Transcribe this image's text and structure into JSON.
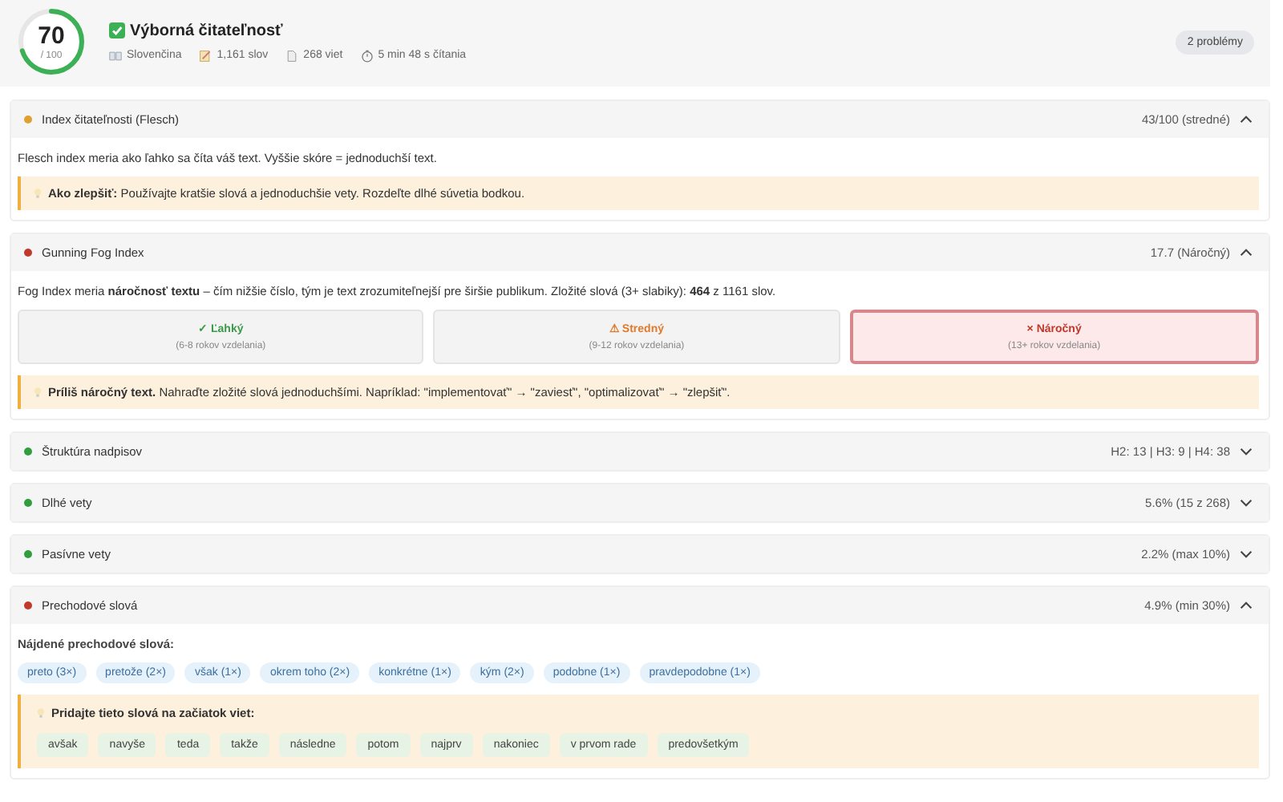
{
  "summary": {
    "score": "70",
    "max": "/ 100",
    "title": "Výborná čitateľnosť",
    "meta": [
      {
        "kind": "language",
        "text": "Slovenčina"
      },
      {
        "kind": "words",
        "text": "1,161 slov"
      },
      {
        "kind": "sentences",
        "text": "268 viet"
      },
      {
        "kind": "time",
        "text": "5 min 48 s čítania"
      }
    ],
    "badge": "2 problémy"
  },
  "sections": [
    {
      "kind": "text",
      "title": "Index čitateľnosti (Flesch)",
      "color": "#e0a030",
      "summary": "43/100 (stredné)",
      "expanded": true,
      "description": "Flesch index meria ako ľahko sa číta váš text. Vyššie skóre = jednoduchší text.",
      "tip": "**Ako zlepšiť:** Používajte kratšie slová a jednoduchšie vety. Rozdeľte dlhé súvetia bodkou."
    },
    {
      "kind": "fog",
      "title": "Gunning Fog Index",
      "color": "#c0392b",
      "summary": "17.7 (Náročný)",
      "expanded": true,
      "description": "Fog Index meria **náročnosť textu** – čím nižšie číslo, tým je text zrozumiteľnejší pre širšie publikum. Zložité slová (3+ slabiky): **464** z 1161 slov.",
      "levels": [
        {
          "kind": "easy",
          "label": "✓ Ľahký",
          "note": "(6-8 rokov vzdelania)",
          "selected": false
        },
        {
          "kind": "medium",
          "label": "⚠ Stredný",
          "note": "(9-12 rokov vzdelania)",
          "selected": false
        },
        {
          "kind": "hard",
          "label": "× Náročný",
          "note": "(13+ rokov vzdelania)",
          "selected": true
        }
      ],
      "tip": "**Príliš náročný text.** Nahraďte zložité slová jednoduchšími. Napríklad: \"implementovať\" → \"zaviesť\", \"optimalizovať\" → \"zlepšiť\"."
    },
    {
      "title": "Štruktúra nadpisov",
      "color": "#2e9e3e",
      "summary": "H2: 13 | H3: 9 | H4: 38",
      "expanded": false
    },
    {
      "title": "Dlhé vety",
      "color": "#2e9e3e",
      "summary": "5.6% (15 z 268)",
      "expanded": false
    },
    {
      "title": "Pasívne vety",
      "color": "#2e9e3e",
      "summary": "2.2% (max 10%)",
      "expanded": false
    },
    {
      "kind": "words",
      "title": "Prechodové slová",
      "color": "#c0392b",
      "summary": "4.9% (min 30%)",
      "expanded": true,
      "found_label": "Nájdené prechodové slová:",
      "found": [
        "preto (3×)",
        "pretože (2×)",
        "však (1×)",
        "okrem toho (2×)",
        "konkrétne (1×)",
        "kým (2×)",
        "podobne (1×)",
        "pravdepodobne (1×)"
      ],
      "tip_label": "Pridajte tieto slová na začiatok viet:",
      "suggestions": [
        "avšak",
        "navyše",
        "teda",
        "takže",
        "následne",
        "potom",
        "najprv",
        "nakoniec",
        "v prvom rade",
        "predovšetkým"
      ]
    }
  ]
}
